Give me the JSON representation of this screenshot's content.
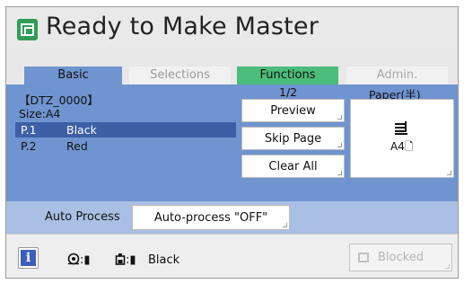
{
  "header": {
    "title": "Ready to Make Master",
    "icon": "master-making-icon",
    "icon_color": "#2f9d57"
  },
  "tabs": [
    {
      "label": "Basic",
      "active": true,
      "color": "#6f94cf"
    },
    {
      "label": "Selections",
      "active": false,
      "enabled": false
    },
    {
      "label": "Functions",
      "active": false,
      "color": "#4cbd7a"
    },
    {
      "label": "Admin.",
      "active": false,
      "enabled": false
    }
  ],
  "job": {
    "name": "【DTZ_0000】",
    "size": "Size:A4",
    "page_indicator": "1/2",
    "pages": [
      {
        "page": "P.1",
        "color": "Black",
        "selected": true
      },
      {
        "page": "P.2",
        "color": "Red",
        "selected": false
      }
    ]
  },
  "buttons": {
    "preview": "Preview",
    "skip_page": "Skip Page",
    "clear_all": "Clear All"
  },
  "paper": {
    "label": "Paper(半)",
    "value": "A4",
    "icon": "paper-stack-icon"
  },
  "auto_process": {
    "label": "Auto Process",
    "value": "Auto-process \"OFF\""
  },
  "footer": {
    "info_icon": "info-icon",
    "drum_icon": "drum-icon",
    "ink_icon": "ink-icon",
    "drum_level": ":▮",
    "ink_level": ":▮",
    "color": "Black",
    "blocked_label": "Blocked"
  },
  "colors": {
    "panel_blue": "#6f94cf",
    "selected_row": "#3d5fa6",
    "auto_bar": "#a9c0e4"
  }
}
